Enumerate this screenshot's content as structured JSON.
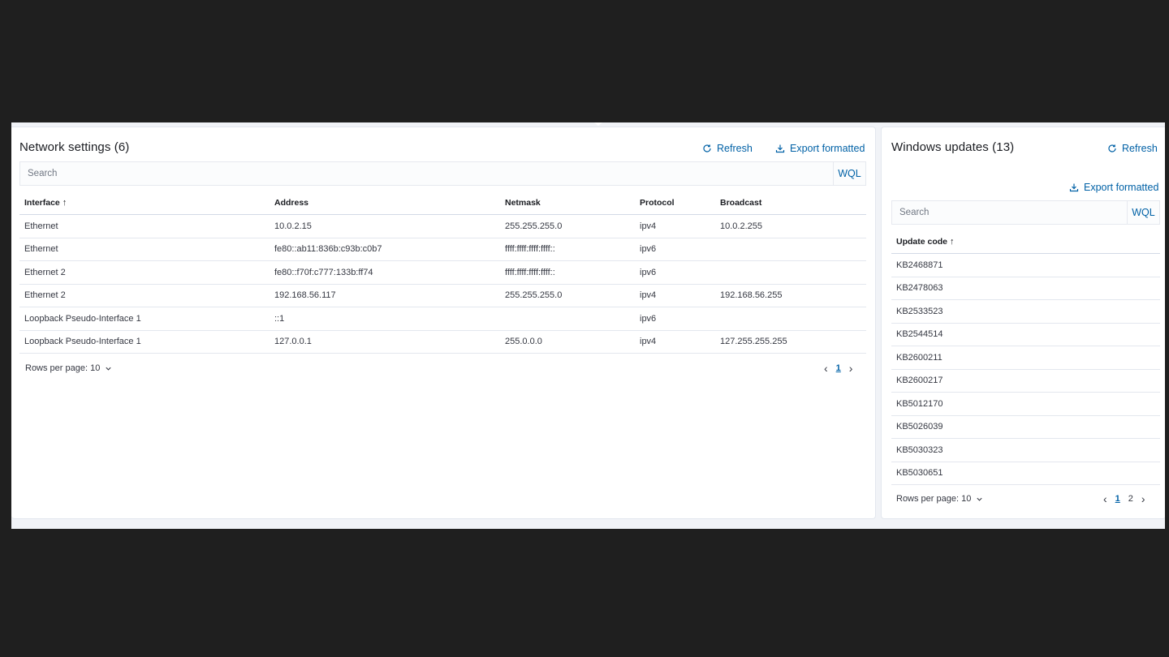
{
  "network": {
    "title": "Network settings (6)",
    "refresh_label": "Refresh",
    "export_label": "Export formatted",
    "search_placeholder": "Search",
    "wql_label": "WQL",
    "columns": [
      "Interface",
      "Address",
      "Netmask",
      "Protocol",
      "Broadcast"
    ],
    "sort_indicator": "↑",
    "rows": [
      [
        "Ethernet",
        "10.0.2.15",
        "255.255.255.0",
        "ipv4",
        "10.0.2.255"
      ],
      [
        "Ethernet",
        "fe80::ab11:836b:c93b:c0b7",
        "ffff:ffff:ffff:ffff::",
        "ipv6",
        ""
      ],
      [
        "Ethernet 2",
        "fe80::f70f:c777:133b:ff74",
        "ffff:ffff:ffff:ffff::",
        "ipv6",
        ""
      ],
      [
        "Ethernet 2",
        "192.168.56.117",
        "255.255.255.0",
        "ipv4",
        "192.168.56.255"
      ],
      [
        "Loopback Pseudo-Interface 1",
        "::1",
        "",
        "ipv6",
        ""
      ],
      [
        "Loopback Pseudo-Interface 1",
        "127.0.0.1",
        "255.0.0.0",
        "ipv4",
        "127.255.255.255"
      ]
    ],
    "rows_per_page": "Rows per page: 10",
    "pages": [
      "1"
    ],
    "current_page": "1"
  },
  "updates": {
    "title": "Windows updates (13)",
    "refresh_label": "Refresh",
    "export_label": "Export formatted",
    "search_placeholder": "Search",
    "wql_label": "WQL",
    "columns": [
      "Update code"
    ],
    "sort_indicator": "↑",
    "rows": [
      [
        "KB2468871"
      ],
      [
        "KB2478063"
      ],
      [
        "KB2533523"
      ],
      [
        "KB2544514"
      ],
      [
        "KB2600211"
      ],
      [
        "KB2600217"
      ],
      [
        "KB5012170"
      ],
      [
        "KB5026039"
      ],
      [
        "KB5030323"
      ],
      [
        "KB5030651"
      ]
    ],
    "rows_per_page": "Rows per page: 10",
    "pages": [
      "1",
      "2"
    ],
    "current_page": "1"
  },
  "icons": {
    "refresh": "refresh-icon",
    "export": "download-icon",
    "sort": "arrow-up-icon",
    "dropdown": "chevron-down-icon",
    "prev": "chevron-left-icon",
    "next": "chevron-right-icon"
  },
  "colors": {
    "background": "#1f1f1f",
    "panel": "#ffffff",
    "link": "#0061a6",
    "text": "#343741"
  }
}
